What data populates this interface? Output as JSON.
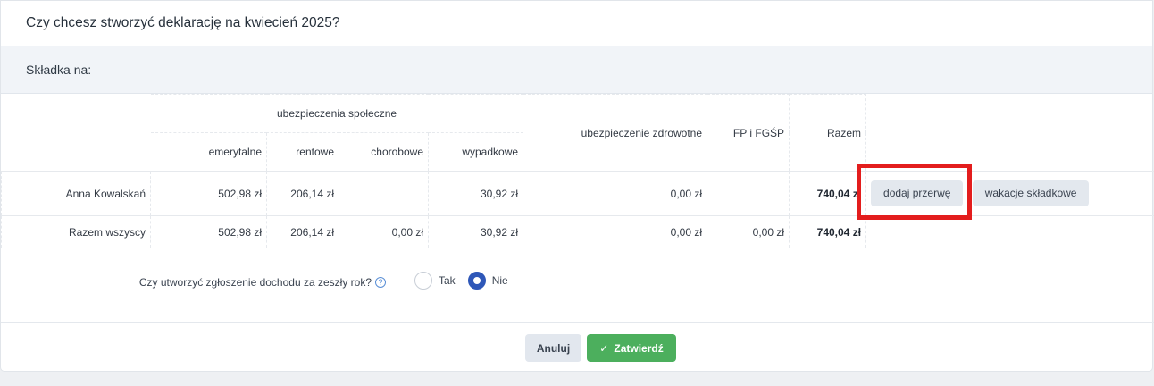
{
  "dialog": {
    "title": "Czy chcesz stworzyć deklarację na kwiecień 2025?",
    "subtitle": "Składka na:"
  },
  "table": {
    "group_header": "ubezpieczenia społeczne",
    "headers": {
      "emerytalne": "emerytalne",
      "rentowe": "rentowe",
      "chorobowe": "chorobowe",
      "wypadkowe": "wypadkowe",
      "zdrowotne": "ubezpieczenie zdrowotne",
      "fp": "FP i FGŚP",
      "razem": "Razem"
    },
    "rows": [
      {
        "name": "Anna Kowalskań",
        "emerytalne": "502,98 zł",
        "rentowe": "206,14 zł",
        "chorobowe": "",
        "wypadkowe": "30,92 zł",
        "zdrowotne": "0,00 zł",
        "fp": "",
        "razem": "740,04 zł",
        "actions": [
          "dodaj przerwę",
          "wakacje składkowe"
        ]
      },
      {
        "name": "Razem wszyscy",
        "emerytalne": "502,98 zł",
        "rentowe": "206,14 zł",
        "chorobowe": "0,00 zł",
        "wypadkowe": "30,92 zł",
        "zdrowotne": "0,00 zł",
        "fp": "0,00 zł",
        "razem": "740,04 zł"
      }
    ]
  },
  "income_question": {
    "label": "Czy utworzyć zgłoszenie dochodu za zeszły rok?",
    "help_icon": "question-circle-icon",
    "options": [
      "Tak",
      "Nie"
    ],
    "selected": "Nie"
  },
  "footer": {
    "cancel_label": "Anuluj",
    "confirm_label": "Zatwierdź",
    "confirm_icon": "check-icon"
  },
  "colors": {
    "confirm": "#4caf5d",
    "radio_selected": "#2e57b8",
    "highlight": "#e31d1d"
  }
}
